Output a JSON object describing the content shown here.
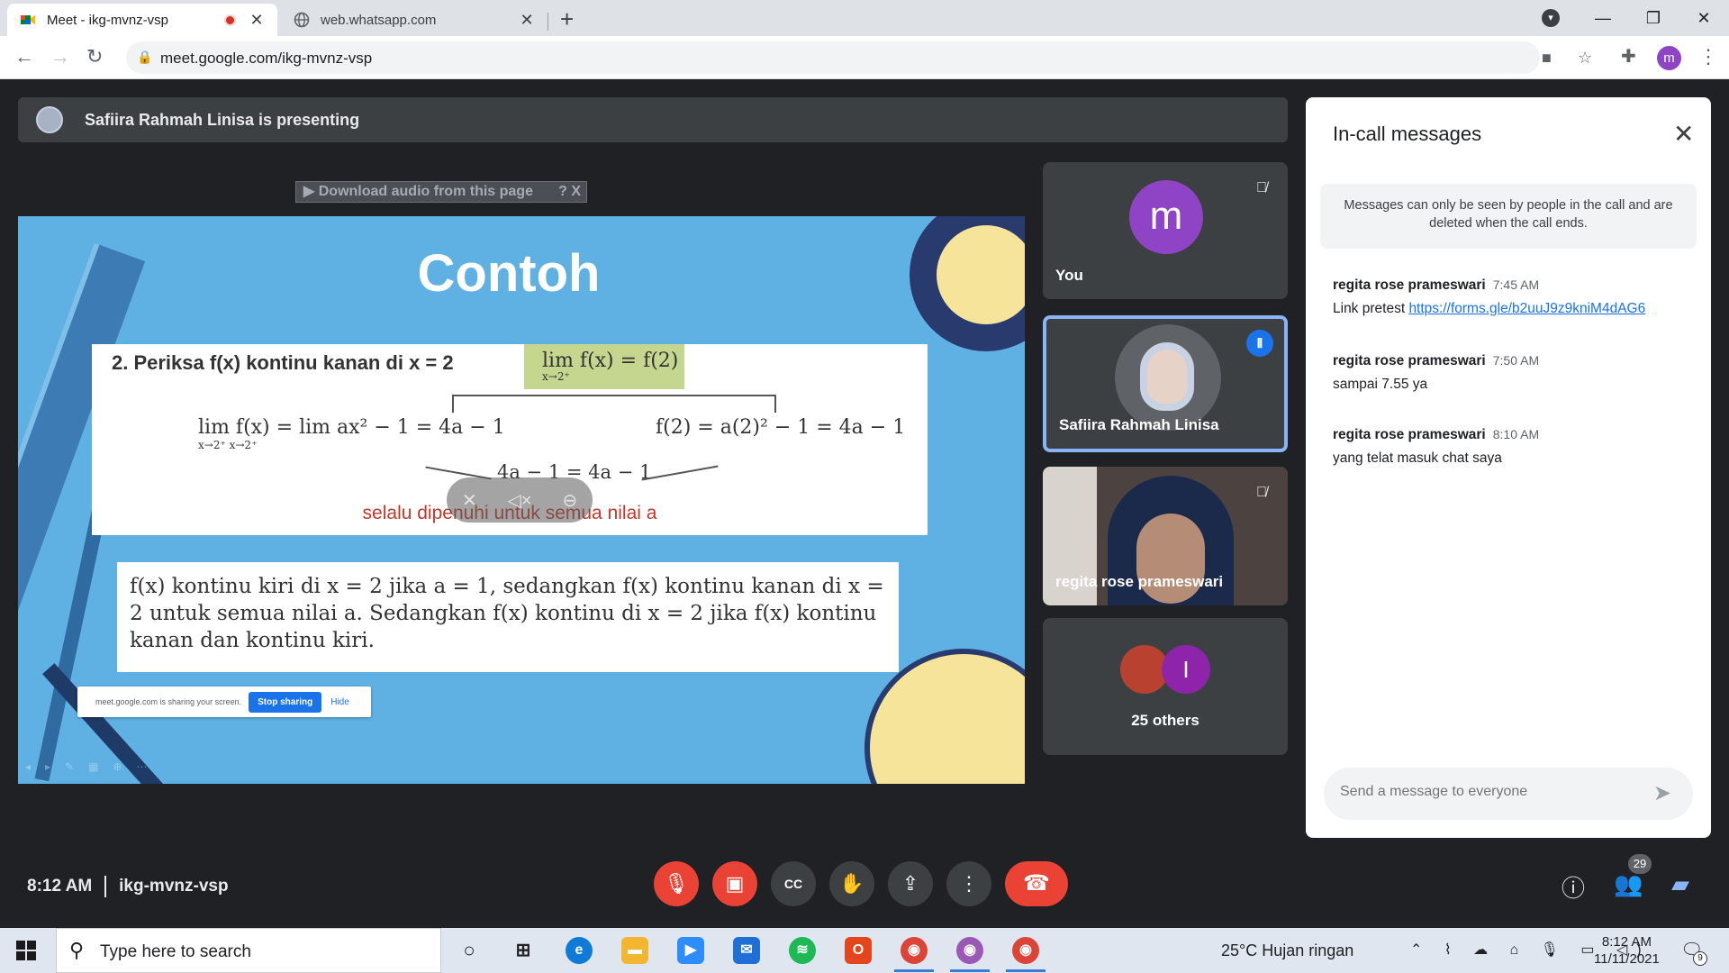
{
  "browser": {
    "tabs": [
      {
        "title": "Meet - ikg-mvnz-vsp",
        "recording": true,
        "active": true
      },
      {
        "title": "web.whatsapp.com",
        "active": false
      }
    ],
    "url": "meet.google.com/ikg-mvnz-vsp",
    "profile_initial": "m"
  },
  "meet": {
    "presenting_text": "Safiira Rahmah Linisa is presenting",
    "download_audio_label": "▶ Download audio from this page",
    "download_audio_extra": "? X",
    "slide": {
      "title": "Contoh",
      "question": "2. Periksa f(x) kontinu kanan di x = 2",
      "highlight_eq": "lim f(x) = f(2)",
      "highlight_sub": "x→2⁺",
      "left_eq": "lim f(x) = lim ax² − 1 = 4a − 1",
      "left_sub": "x→2⁺          x→2⁺",
      "right_eq": "f(2) = a(2)² − 1 = 4a − 1",
      "middle_eq": "4a − 1 = 4a − 1",
      "conclusion": "selalu dipenuhi untuk semua nilai a",
      "summary": "f(x) kontinu kiri di x = 2 jika a = 1, sedangkan f(x) kontinu kanan di x = 2 untuk semua nilai a. Sedangkan f(x) kontinu di x = 2 jika f(x) kontinu kanan dan kontinu kiri."
    },
    "share_bar": {
      "text": "meet.google.com is sharing your screen.",
      "stop_label": "Stop sharing",
      "hide_label": "Hide"
    },
    "participants": [
      {
        "name": "You",
        "initial": "m",
        "muted": true
      },
      {
        "name": "Safiira Rahmah Linisa",
        "speaking": true
      },
      {
        "name": "regita rose prameswari",
        "muted": true
      },
      {
        "name": "25 others",
        "initial": "I"
      }
    ],
    "meeting_time": "8:12 AM",
    "meeting_code": "ikg-mvnz-vsp",
    "people_count": "29"
  },
  "chat": {
    "title": "In-call messages",
    "notice": "Messages can only be seen by people in the call and are deleted when the call ends.",
    "messages": [
      {
        "sender": "regita rose prameswari",
        "time": "7:45 AM",
        "text": "Link pretest ",
        "link": "https://forms.gle/b2uuJ9z9kniM4dAG6"
      },
      {
        "sender": "regita rose prameswari",
        "time": "7:50 AM",
        "text": "sampai 7.55 ya"
      },
      {
        "sender": "regita rose prameswari",
        "time": "8:10 AM",
        "text": "yang telat masuk chat saya"
      }
    ],
    "input_placeholder": "Send a message to everyone"
  },
  "taskbar": {
    "search_placeholder": "Type here to search",
    "weather": "25°C  Hujan ringan",
    "time": "8:12 AM",
    "date": "11/11/2021",
    "notification_count": "9"
  },
  "colors": {
    "meet_bg": "#202124",
    "tile_bg": "#3c4043",
    "red": "#ea4335",
    "blue": "#1a73e8",
    "avatar_purple": "#8e44c4",
    "slide_blue": "#5fb0e3"
  }
}
